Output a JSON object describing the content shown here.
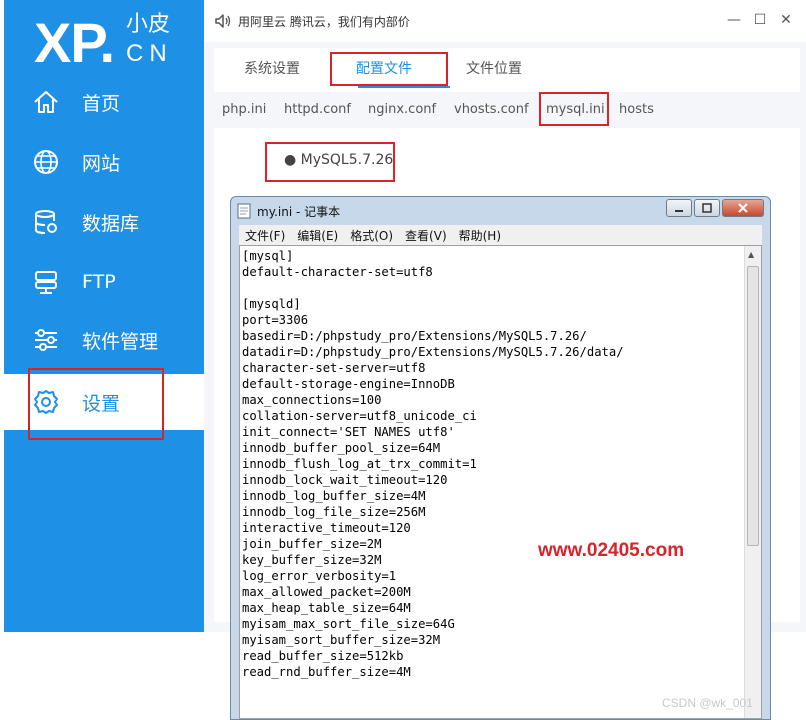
{
  "brand": {
    "logo": "XP.",
    "sub": "小皮",
    "cn": "CN"
  },
  "sidebar": {
    "items": [
      {
        "label": "首页",
        "icon": "home-icon"
      },
      {
        "label": "网站",
        "icon": "globe-icon"
      },
      {
        "label": "数据库",
        "icon": "database-icon"
      },
      {
        "label": "FTP",
        "icon": "server-icon"
      },
      {
        "label": "软件管理",
        "icon": "sliders-icon"
      },
      {
        "label": "设置",
        "icon": "gear-icon"
      }
    ],
    "active": "设置"
  },
  "titlebar": {
    "notice": "用阿里云 腾讯云，我们有内部价",
    "controls": [
      "—",
      "☐",
      "✕"
    ]
  },
  "tabs": {
    "items": [
      "系统设置",
      "配置文件",
      "文件位置"
    ],
    "active": "配置文件"
  },
  "subtabs": {
    "items": [
      "php.ini",
      "httpd.conf",
      "nginx.conf",
      "vhosts.conf",
      "mysql.ini",
      "hosts"
    ],
    "active": "mysql.ini"
  },
  "content": {
    "version": "● MySQL5.7.26"
  },
  "notepad": {
    "title": "my.ini - 记事本",
    "menus": [
      "文件(F)",
      "编辑(E)",
      "格式(O)",
      "查看(V)",
      "帮助(H)"
    ],
    "lines": [
      "[mysql]",
      "default-character-set=utf8",
      "",
      "[mysqld]",
      "port=3306",
      "basedir=D:/phpstudy_pro/Extensions/MySQL5.7.26/",
      "datadir=D:/phpstudy_pro/Extensions/MySQL5.7.26/data/",
      "character-set-server=utf8",
      "default-storage-engine=InnoDB",
      "max_connections=100",
      "collation-server=utf8_unicode_ci",
      "init_connect='SET NAMES utf8'",
      "innodb_buffer_pool_size=64M",
      "innodb_flush_log_at_trx_commit=1",
      "innodb_lock_wait_timeout=120",
      "innodb_log_buffer_size=4M",
      "innodb_log_file_size=256M",
      "interactive_timeout=120",
      "join_buffer_size=2M",
      "key_buffer_size=32M",
      "log_error_verbosity=1",
      "max_allowed_packet=200M",
      "max_heap_table_size=64M",
      "myisam_max_sort_file_size=64G",
      "myisam_sort_buffer_size=32M",
      "read_buffer_size=512kb",
      "read_rnd_buffer_size=4M"
    ]
  },
  "watermark": "www.02405.com",
  "csdn_mark": "CSDN @wk_001",
  "colors": {
    "sidebar": "#1e90e6",
    "highlight": "#d9232b",
    "accent": "#1e90e6"
  }
}
